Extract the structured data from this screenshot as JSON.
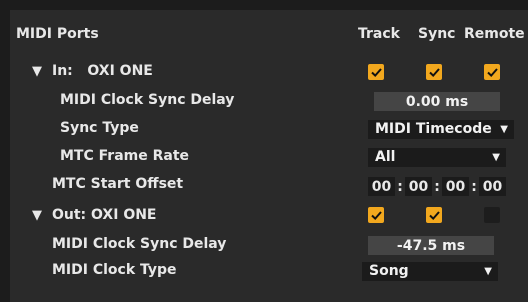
{
  "header": {
    "title": "MIDI Ports",
    "col_track": "Track",
    "col_sync": "Sync",
    "col_remote": "Remote"
  },
  "input_port": {
    "label": "In:   OXI ONE",
    "expand_glyph": "▼",
    "track": true,
    "sync": true,
    "remote": true,
    "clock_sync_delay_label": "MIDI Clock Sync Delay",
    "clock_sync_delay_value": "0.00 ms",
    "sync_type_label": "Sync Type",
    "sync_type_value": "MIDI Timecode",
    "mtc_frame_rate_label": "MTC Frame Rate",
    "mtc_frame_rate_value": "All",
    "mtc_start_offset_label": "MTC Start Offset",
    "mtc_start_offset": [
      "00",
      "00",
      "00",
      "00"
    ],
    "timecode_separator": ":",
    "dropdown_glyph": "▼"
  },
  "output_port": {
    "label": "Out: OXI ONE",
    "expand_glyph": "▼",
    "track": true,
    "sync": true,
    "remote": false,
    "clock_sync_delay_label": "MIDI Clock Sync Delay",
    "clock_sync_delay_value": "-47.5 ms",
    "clock_type_label": "MIDI Clock Type",
    "clock_type_value": "Song",
    "dropdown_glyph": "▼"
  },
  "colors": {
    "accent": "#f2a81e",
    "panel": "#2a2a2a",
    "field": "#454545",
    "select": "#1b1b1b"
  },
  "icons": [
    "expand-triangle-icon",
    "checkmark-icon",
    "dropdown-arrow-icon"
  ]
}
